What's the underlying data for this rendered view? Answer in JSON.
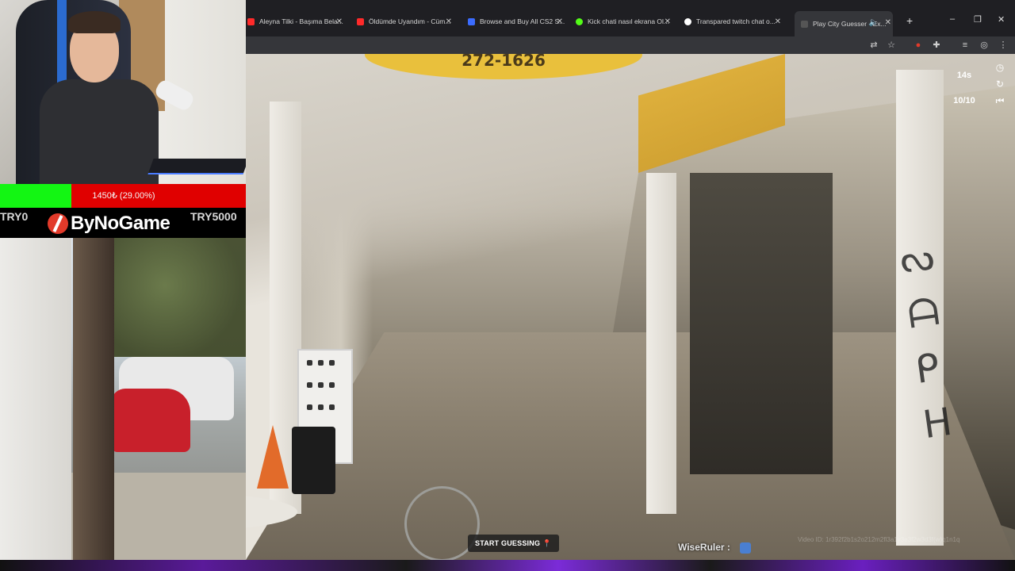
{
  "browser": {
    "tabs": [
      {
        "label": "Aleyna Tilki - Başıma Bela...",
        "icon": "youtube-icon",
        "color": "#ff2a2a"
      },
      {
        "label": "Öldümde Uyandım - Cüm...",
        "icon": "youtube-icon",
        "color": "#ff2a2a"
      },
      {
        "label": "Browse and Buy All CS2 S...",
        "icon": "site-icon",
        "color": "#3b6cff"
      },
      {
        "label": "Kick chati nasıl ekrana Ol...",
        "icon": "kick-icon",
        "color": "#53fc18"
      },
      {
        "label": "Transpared twitch chat o...",
        "icon": "google-icon",
        "color": "#ffffff"
      },
      {
        "label": "Play City Guesser - Ex...",
        "icon": "cityguesser-icon",
        "color": "#555555"
      }
    ],
    "new_tab": "+",
    "window_buttons": [
      "–",
      "❐",
      "✕"
    ]
  },
  "game": {
    "timer": "14s",
    "round": "10/10",
    "start_button": "START GUESSING",
    "chat_user": "WiseRuler :",
    "video_id": "Video ID: 1r392f2b1s2o212m2fl3a1y3e3f2w3d3f(w)q1n1q",
    "scene_sign": "272-1626"
  },
  "overlay": {
    "goal_text": "1450₺ (29.00%)",
    "goal_progress": 0.29,
    "goal_start": "TRY0",
    "goal_end": "TRY5000",
    "brand": "ByNoGame",
    "colors": {
      "goal_fill": "#13f613",
      "goal_bg": "#e00000"
    }
  }
}
